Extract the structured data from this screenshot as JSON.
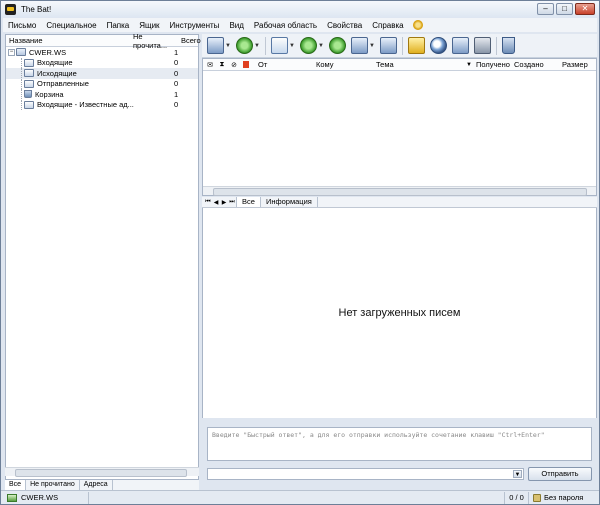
{
  "window": {
    "title": "The Bat!"
  },
  "menu": [
    "Письмо",
    "Специальное",
    "Папка",
    "Ящик",
    "Инструменты",
    "Вид",
    "Рабочая область",
    "Свойства",
    "Справка"
  ],
  "folder_tree": {
    "headers": {
      "name": "Название",
      "unread": "Не прочита...",
      "total": "Всего"
    },
    "account": {
      "name": "CWER.WS",
      "total": "1"
    },
    "folders": [
      {
        "name": "Входящие",
        "total": "0",
        "icon": "inbox-icon"
      },
      {
        "name": "Исходящие",
        "total": "0",
        "icon": "outbox-icon"
      },
      {
        "name": "Отправленные",
        "total": "0",
        "icon": "sent-icon"
      },
      {
        "name": "Корзина",
        "total": "1",
        "icon": "trash-icon"
      },
      {
        "name": "Входящие - Известные ад...",
        "total": "0",
        "icon": "inbox-icon"
      }
    ]
  },
  "left_tabs": [
    "Все",
    "Не прочитано",
    "Адреса"
  ],
  "message_list": {
    "columns": {
      "from": "От",
      "to": "Кому",
      "subject": "Тема",
      "received": "Получено",
      "created": "Создано",
      "size": "Размер"
    }
  },
  "preview_tabs": [
    "Все",
    "Информация"
  ],
  "preview": {
    "empty_text": "Нет загруженных писем"
  },
  "quick_reply": {
    "placeholder": "Введите \"Быстрый ответ\", а для его отправки используйте сочетание клавиш \"Ctrl+Enter\"",
    "send_label": "Отправить"
  },
  "status_bar": {
    "account": "CWER.WS",
    "count": "0 / 0",
    "password": "Без пароля"
  },
  "colors": {
    "accent": "#dfe6f0",
    "selected_row": "#e6ebf2",
    "flag": "#e04020"
  }
}
